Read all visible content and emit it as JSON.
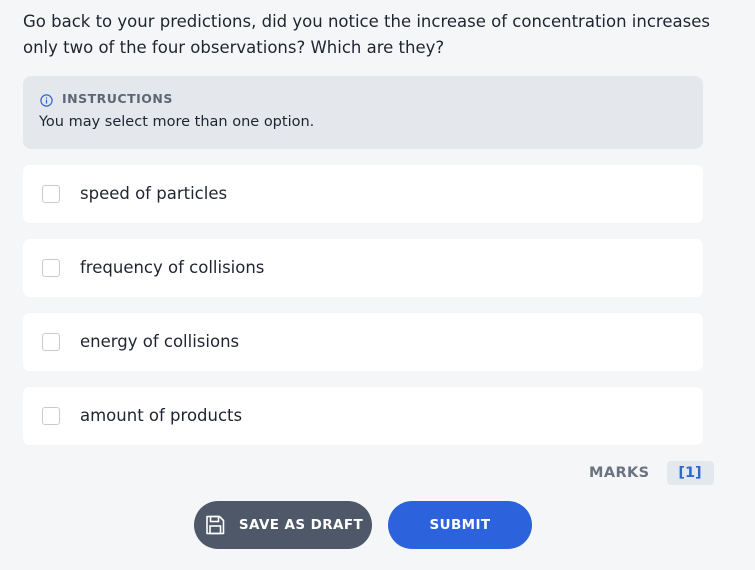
{
  "question": {
    "text": "Go back to your predictions, did you notice the increase of concentration increases only two of the four observations? Which are they?"
  },
  "instructions": {
    "icon": "info-icon",
    "title": "INSTRUCTIONS",
    "text": "You may select more than one option."
  },
  "options": [
    {
      "label": "speed of particles",
      "checked": false
    },
    {
      "label": "frequency of collisions",
      "checked": false
    },
    {
      "label": "energy of collisions",
      "checked": false
    },
    {
      "label": "amount of products",
      "checked": false
    }
  ],
  "marks": {
    "label": "MARKS",
    "value": "[1]"
  },
  "buttons": {
    "save_draft": {
      "label": "SAVE AS DRAFT",
      "icon": "save-icon"
    },
    "submit": {
      "label": "SUBMIT"
    }
  },
  "colors": {
    "background": "#f5f6f8",
    "accent": "#2c62dc",
    "draft_button": "#4e5868",
    "instructions_bg": "#e4e7ec"
  }
}
